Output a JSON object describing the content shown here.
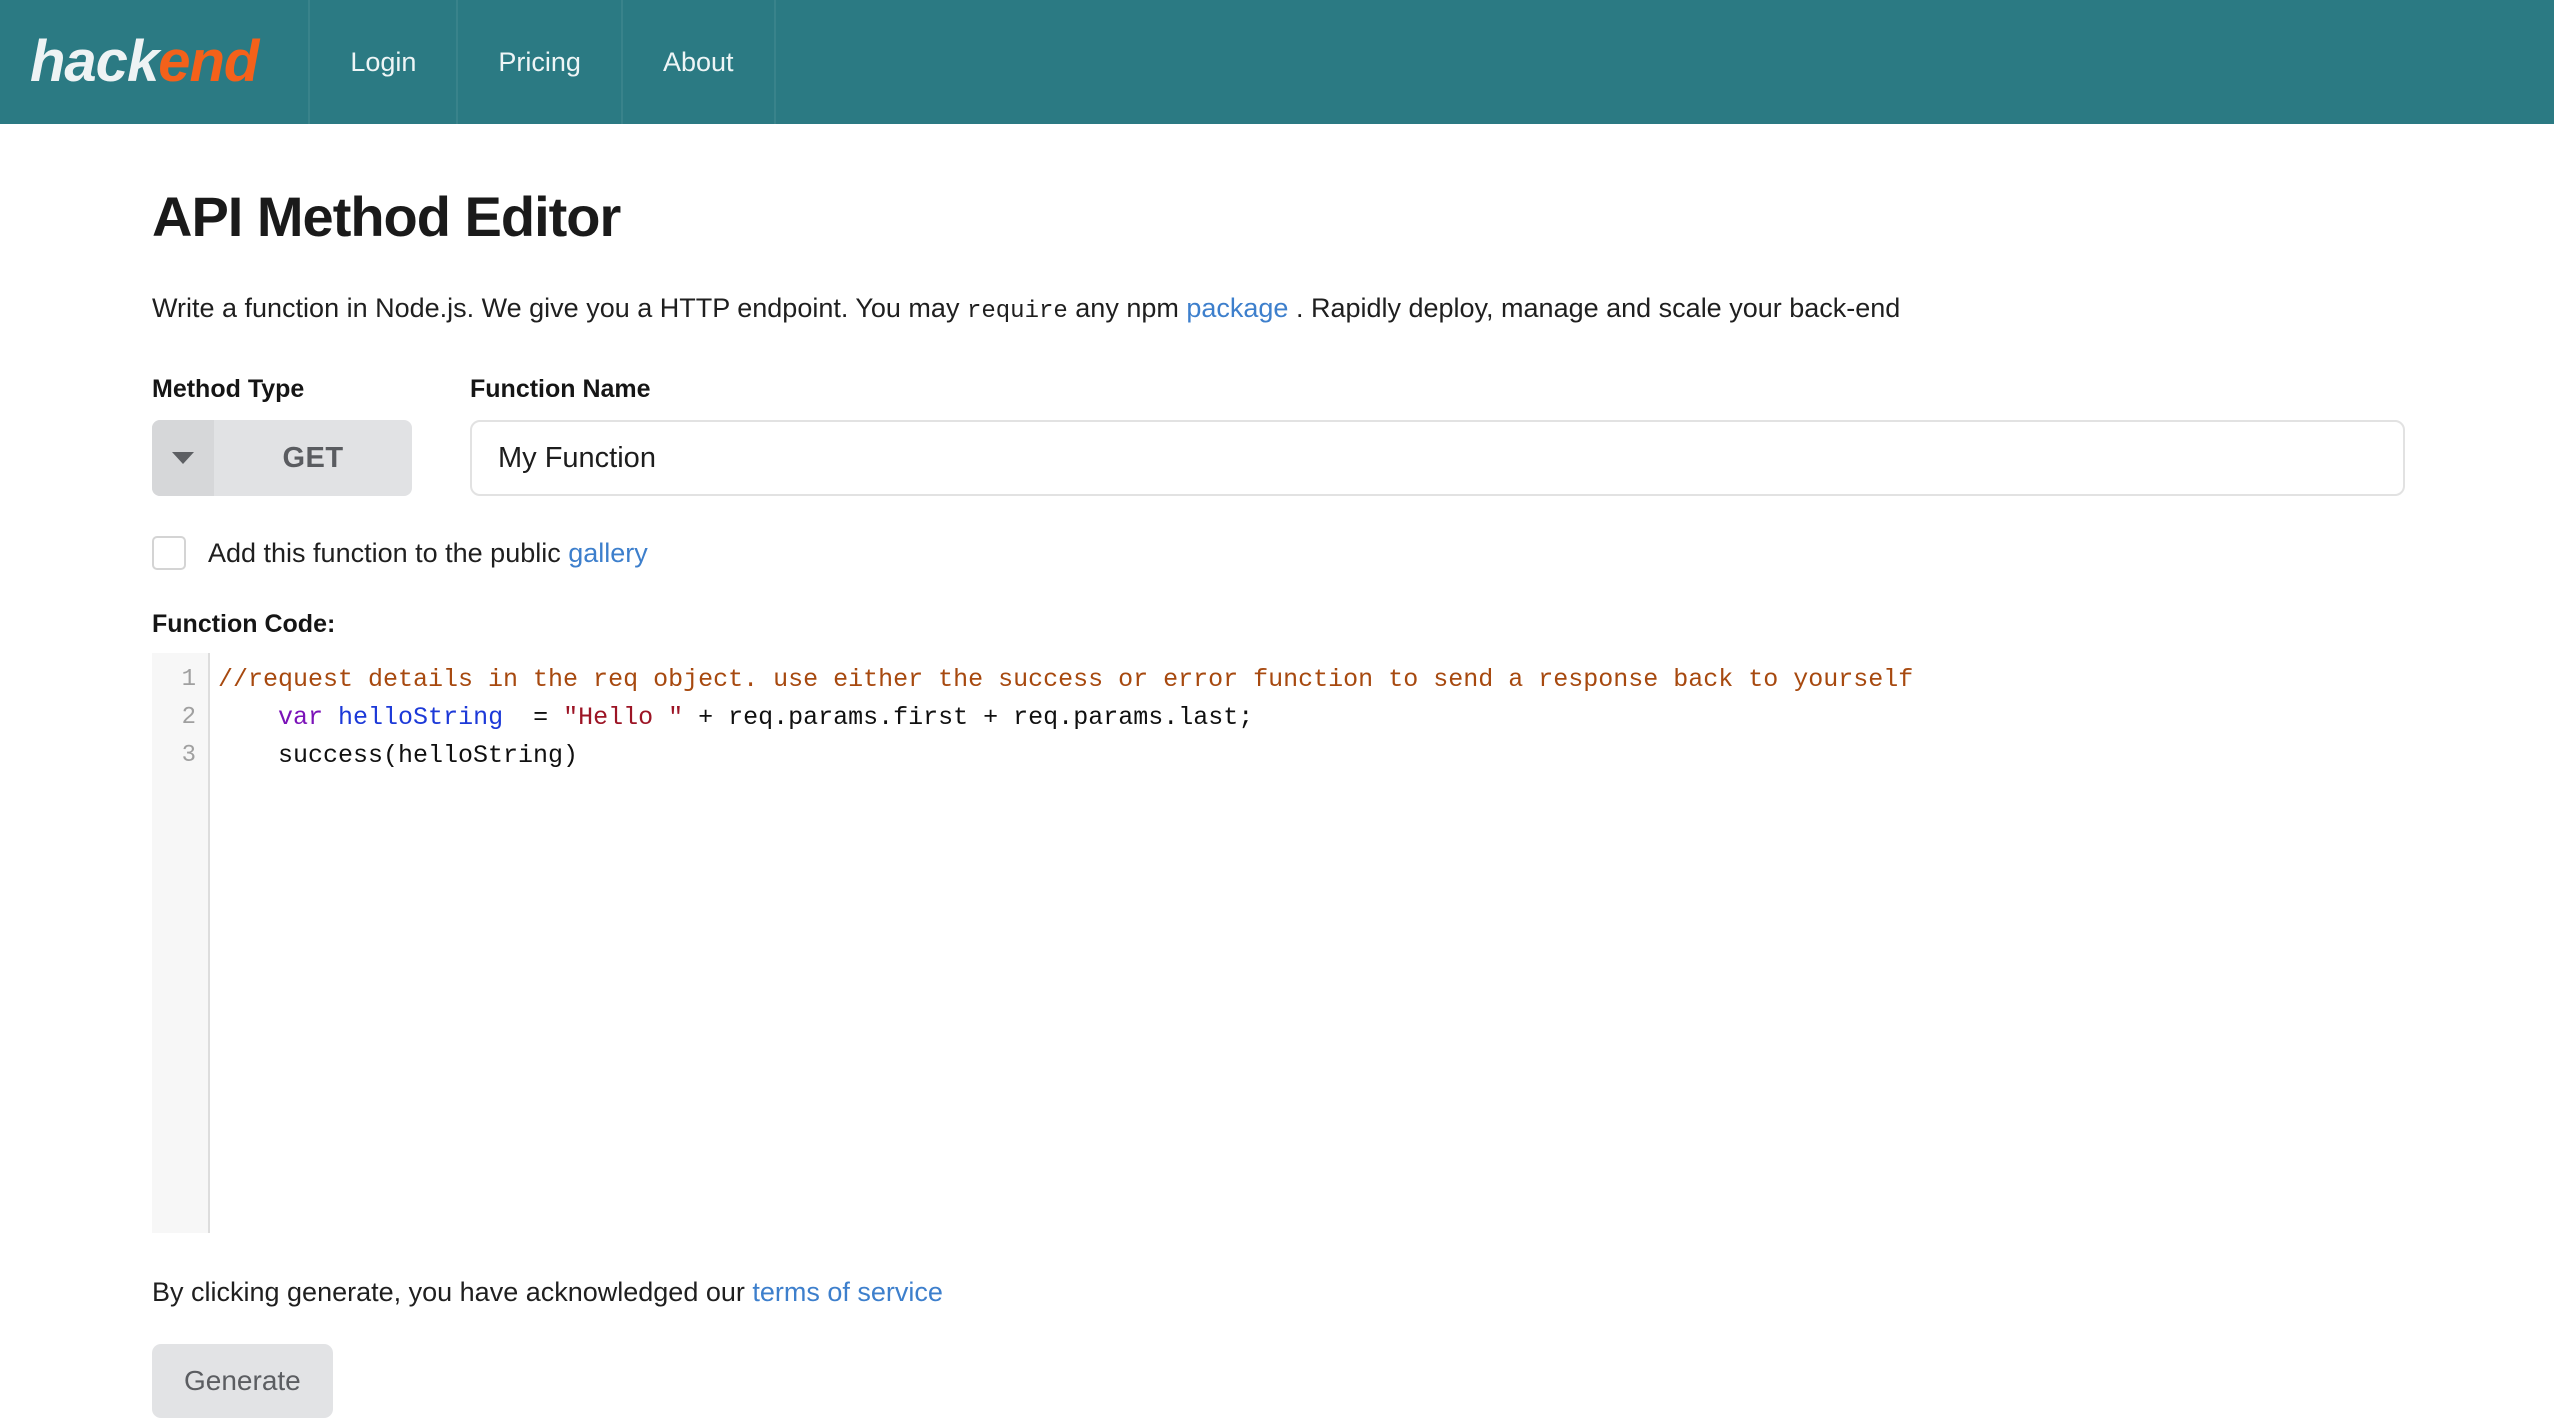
{
  "theme": {
    "navbar_bg": "#2b7a83",
    "brand_accent": "#f4611a",
    "link_color": "#3d7fcc",
    "button_bg": "#e2e3e5"
  },
  "navbar": {
    "brand": {
      "first": "hack",
      "second": "end"
    },
    "items": [
      {
        "label": "Login"
      },
      {
        "label": "Pricing"
      },
      {
        "label": "About"
      }
    ]
  },
  "main": {
    "title": "API Method Editor",
    "description": {
      "part1": "Write a function in Node.js. We give you a HTTP endpoint. You may ",
      "code": "require",
      "part2": " any npm ",
      "link": "package",
      "part3": " . Rapidly deploy, manage and scale your back-end"
    },
    "method_type": {
      "label": "Method Type",
      "value": "GET",
      "caret_icon": "chevron-down-icon"
    },
    "function_name": {
      "label": "Function Name",
      "value": "My Function",
      "placeholder": "My Function"
    },
    "gallery_checkbox": {
      "checked": false,
      "text": "Add this function to the public ",
      "link": "gallery"
    },
    "code": {
      "label": "Function Code:",
      "line_numbers": [
        "1",
        "2",
        "3"
      ],
      "lines": [
        {
          "tokens": [
            {
              "type": "comment",
              "text": "//request details in the req object. use either the success or error function to send a response back to yourself"
            }
          ]
        },
        {
          "tokens": [
            {
              "type": "plain",
              "text": "    "
            },
            {
              "type": "kw",
              "text": "var"
            },
            {
              "type": "plain",
              "text": " "
            },
            {
              "type": "var",
              "text": "helloString"
            },
            {
              "type": "plain",
              "text": "  = "
            },
            {
              "type": "str",
              "text": "\"Hello \""
            },
            {
              "type": "plain",
              "text": " + req.params.first + req.params.last;"
            }
          ]
        },
        {
          "tokens": [
            {
              "type": "plain",
              "text": "    success(helloString)"
            }
          ]
        }
      ]
    },
    "terms": {
      "text": "By clicking generate, you have acknowledged our ",
      "link": "terms of service"
    },
    "generate_button": "Generate"
  }
}
